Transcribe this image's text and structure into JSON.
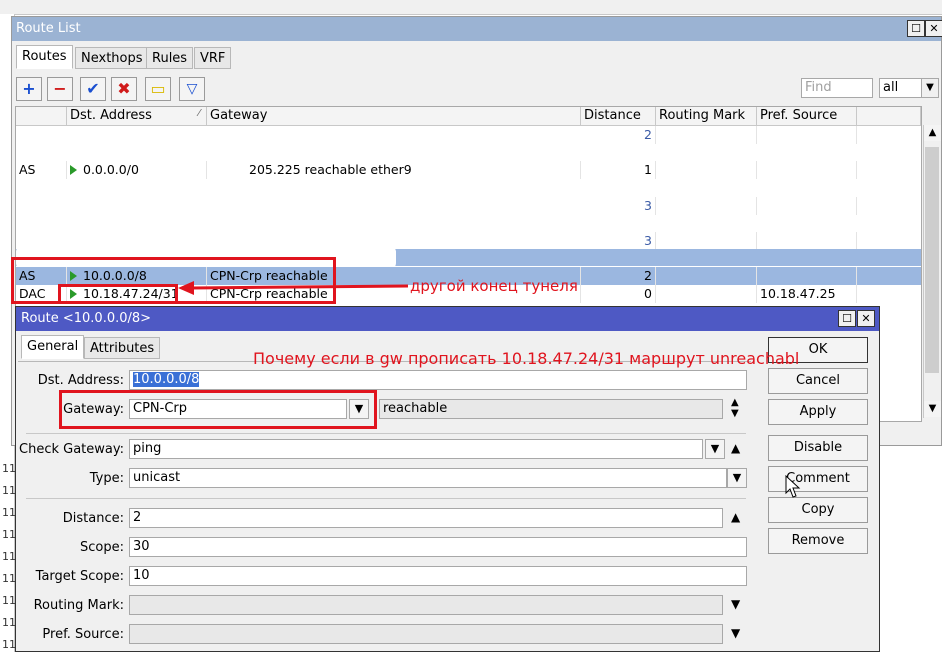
{
  "route_list": {
    "title": "Route List",
    "tabs": [
      "Routes",
      "Nexthops",
      "Rules",
      "VRF"
    ],
    "find_placeholder": "Find",
    "filter_value": "all",
    "columns": [
      "",
      "Dst. Address",
      "Gateway",
      "Distance",
      "Routing Mark",
      "Pref. Source"
    ],
    "rows": [
      {
        "flags": "",
        "dst": "",
        "gateway": "",
        "distance": "2",
        "pref_source": ""
      },
      {
        "flags": "AS",
        "dst": "0.0.0.0/0",
        "gateway": "205.225 reachable ether9",
        "distance": "1",
        "pref_source": ""
      },
      {
        "flags": "",
        "dst": "",
        "gateway": "",
        "distance": "",
        "pref_source": ""
      },
      {
        "flags": "",
        "dst": "",
        "gateway": "",
        "distance": "3",
        "pref_source": ""
      },
      {
        "flags": "",
        "dst": "",
        "gateway": "",
        "distance": "3",
        "pref_source": ""
      },
      {
        "flags": "",
        "dst": "",
        "gateway": "",
        "distance": "",
        "pref_source": ""
      },
      {
        "flags": "AS",
        "dst": "10.0.0.0/8",
        "gateway": "CPN-Crp reachable",
        "distance": "2",
        "pref_source": ""
      },
      {
        "flags": "DAC",
        "dst": "10.18.47.24/31",
        "gateway": "CPN-Crp reachable",
        "distance": "0",
        "pref_source": "10.18.47.25"
      }
    ]
  },
  "annotations": {
    "tunnel_end": "другой конец тунеля",
    "question": "Почему если в gw прописать 10.18.47.24/31 маршрут unreachabl"
  },
  "route_dialog": {
    "title": "Route <10.0.0.0/8>",
    "tabs": [
      "General",
      "Attributes"
    ],
    "fields": {
      "dst_address": {
        "label": "Dst. Address:",
        "value": "10.0.0.0/8"
      },
      "gateway": {
        "label": "Gateway:",
        "value": "CPN-Crp",
        "status": "reachable"
      },
      "check_gateway": {
        "label": "Check Gateway:",
        "value": "ping"
      },
      "type": {
        "label": "Type:",
        "value": "unicast"
      },
      "distance": {
        "label": "Distance:",
        "value": "2"
      },
      "scope": {
        "label": "Scope:",
        "value": "30"
      },
      "target_scope": {
        "label": "Target Scope:",
        "value": "10"
      },
      "routing_mark": {
        "label": "Routing Mark:",
        "value": ""
      },
      "pref_source": {
        "label": "Pref. Source:",
        "value": ""
      }
    },
    "buttons": {
      "ok": "OK",
      "cancel": "Cancel",
      "apply": "Apply",
      "disable": "Disable",
      "comment": "Comment",
      "copy": "Copy",
      "remove": "Remove"
    }
  },
  "background_log": {
    "line_prefix": "11"
  },
  "colors": {
    "title_inactive": "#9bb3d3",
    "title_active": "#4e59c4",
    "selected_row": "#9bb7e0",
    "annotation_red": "#e0141e"
  }
}
